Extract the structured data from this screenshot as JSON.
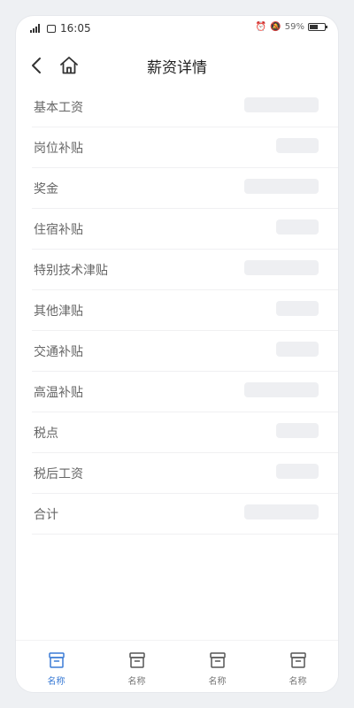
{
  "status_bar": {
    "network": "4G",
    "time": "16:05",
    "battery_percent": "59%",
    "battery_level": 0.59
  },
  "header": {
    "title": "薪资详情"
  },
  "salary_items": [
    {
      "label": "基本工资",
      "value_width": "long"
    },
    {
      "label": "岗位补贴",
      "value_width": "short"
    },
    {
      "label": "奖金",
      "value_width": "long"
    },
    {
      "label": "住宿补贴",
      "value_width": "short"
    },
    {
      "label": "特别技术津贴",
      "value_width": "long"
    },
    {
      "label": "其他津贴",
      "value_width": "short"
    },
    {
      "label": "交通补贴",
      "value_width": "short"
    },
    {
      "label": "高温补贴",
      "value_width": "long"
    },
    {
      "label": "税点",
      "value_width": "short"
    },
    {
      "label": "税后工资",
      "value_width": "short"
    },
    {
      "label": "合计",
      "value_width": "long"
    }
  ],
  "tab_bar": {
    "tabs": [
      {
        "label": "名称",
        "active": true
      },
      {
        "label": "名称",
        "active": false
      },
      {
        "label": "名称",
        "active": false
      },
      {
        "label": "名称",
        "active": false
      }
    ]
  },
  "colors": {
    "accent": "#3a7bd5",
    "placeholder": "#eeeff2",
    "background": "#eef0f3"
  }
}
